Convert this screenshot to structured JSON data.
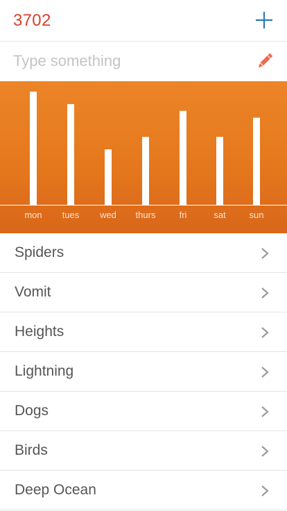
{
  "header": {
    "count": "3702",
    "add_icon": "plus-icon"
  },
  "input": {
    "placeholder": "Type something",
    "value": "",
    "edit_icon": "pencil-icon"
  },
  "colors": {
    "accent_red": "#d9412a",
    "accent_blue": "#2a7ab8",
    "pencil": "#ee6a4f",
    "chart_bg": "#e5781d",
    "bar": "#ffffff"
  },
  "chart_data": {
    "type": "bar",
    "categories": [
      "mon",
      "tues",
      "wed",
      "thurs",
      "fri",
      "sat",
      "sun"
    ],
    "values": [
      100,
      89,
      49,
      60,
      83,
      60,
      77
    ],
    "ylim": [
      0,
      100
    ],
    "grid": false,
    "title": "",
    "xlabel": "",
    "ylabel": ""
  },
  "list": {
    "items": [
      {
        "label": "Spiders"
      },
      {
        "label": "Vomit"
      },
      {
        "label": "Heights"
      },
      {
        "label": "Lightning"
      },
      {
        "label": "Dogs"
      },
      {
        "label": "Birds"
      },
      {
        "label": "Deep Ocean"
      }
    ],
    "chevron_icon": "chevron-right-icon"
  }
}
